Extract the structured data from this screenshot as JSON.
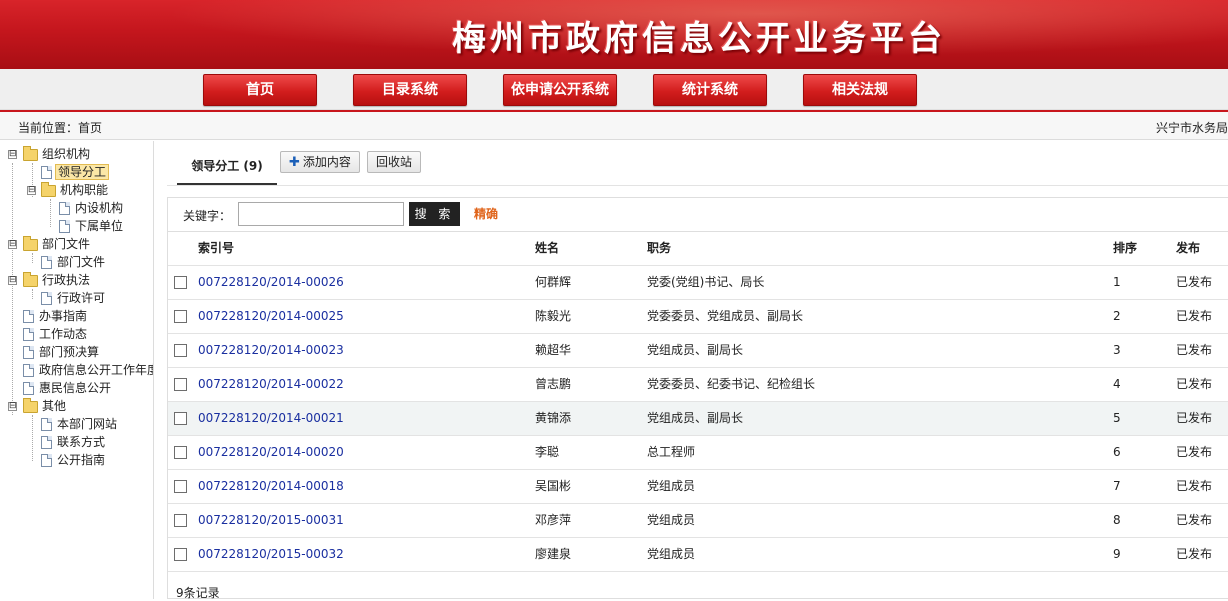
{
  "site_title": "梅州市政府信息公开业务平台",
  "nav": [
    "首页",
    "目录系统",
    "依申请公开系统",
    "统计系统",
    "相关法规"
  ],
  "breadcrumb": "当前位置：首页",
  "unit_name": "兴宁市水务局",
  "tree": {
    "toggle_minus": "⊟",
    "items": [
      "组织机构",
      "领导分工",
      "机构职能",
      "内设机构",
      "下属单位",
      "部门文件",
      "部门文件",
      "行政执法",
      "行政许可",
      "办事指南",
      "工作动态",
      "部门预决算",
      "政府信息公开工作年度",
      "惠民信息公开",
      "其他",
      "本部门网站",
      "联系方式",
      "公开指南"
    ]
  },
  "tabs": {
    "active": "领导分工 (9)",
    "add": "添加内容",
    "add_icon": "plus-icon",
    "recycle": "回收站"
  },
  "search": {
    "label": "关键字：",
    "value": "",
    "button": "搜 索",
    "precise": "精确"
  },
  "table": {
    "headers": [
      "索引号",
      "姓名",
      "职务",
      "排序",
      "发布"
    ],
    "rows": [
      {
        "index": "007228120/2014-00026",
        "name": "何群辉",
        "title": "党委(党组)书记、局长",
        "sort": "1",
        "status": "已发布"
      },
      {
        "index": "007228120/2014-00025",
        "name": "陈毅光",
        "title": "党委委员、党组成员、副局长",
        "sort": "2",
        "status": "已发布"
      },
      {
        "index": "007228120/2014-00023",
        "name": "赖超华",
        "title": "党组成员、副局长",
        "sort": "3",
        "status": "已发布"
      },
      {
        "index": "007228120/2014-00022",
        "name": "曾志鹏",
        "title": "党委委员、纪委书记、纪检组长",
        "sort": "4",
        "status": "已发布"
      },
      {
        "index": "007228120/2014-00021",
        "name": "黄锦添",
        "title": "党组成员、副局长",
        "sort": "5",
        "status": "已发布"
      },
      {
        "index": "007228120/2014-00020",
        "name": "李聪",
        "title": "总工程师",
        "sort": "6",
        "status": "已发布"
      },
      {
        "index": "007228120/2014-00018",
        "name": "吴国彬",
        "title": "党组成员",
        "sort": "7",
        "status": "已发布"
      },
      {
        "index": "007228120/2015-00031",
        "name": "邓彦萍",
        "title": "党组成员",
        "sort": "8",
        "status": "已发布"
      },
      {
        "index": "007228120/2015-00032",
        "name": "廖建泉",
        "title": "党组成员",
        "sort": "9",
        "status": "已发布"
      }
    ]
  },
  "record_count": "9条记录",
  "colors": {
    "brand_red": "#c4161d",
    "link_blue": "#1a2fa0",
    "accent_orange": "#e0651c"
  }
}
